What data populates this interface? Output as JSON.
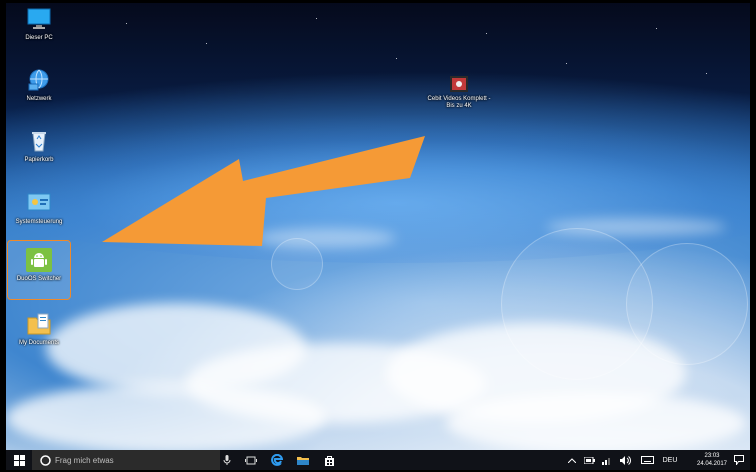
{
  "desktop": {
    "icons": [
      {
        "label": "Dieser PC",
        "icon": "this-pc-icon"
      },
      {
        "label": "Netzwerk",
        "icon": "network-icon"
      },
      {
        "label": "Papierkorb",
        "icon": "recycle-bin-icon"
      },
      {
        "label": "Systemsteuerung",
        "icon": "control-panel-icon"
      },
      {
        "label": "DuoOS Switcher",
        "icon": "android-icon"
      },
      {
        "label": "My Documents",
        "icon": "documents-folder-icon"
      }
    ],
    "video_icon": {
      "label": "Cebit Videos Komplett - Bis zu 4K",
      "icon": "video-folder-icon"
    },
    "arrow_color": "#f59a36",
    "selection_color": "#f08a2a"
  },
  "taskbar": {
    "search_placeholder": "Frag mich etwas",
    "icons": [
      "windows-start-icon",
      "search-circle-icon",
      "microphone-icon",
      "task-view-icon",
      "edge-icon",
      "file-explorer-icon",
      "store-icon"
    ],
    "tray": {
      "icons": [
        "chevron-up-icon",
        "battery-icon",
        "network-signal-icon",
        "volume-icon",
        "keyboard-icon"
      ],
      "language": "DEU",
      "time": "23:03",
      "date": "24.04.2017",
      "notification_icon": "action-center-icon"
    }
  }
}
